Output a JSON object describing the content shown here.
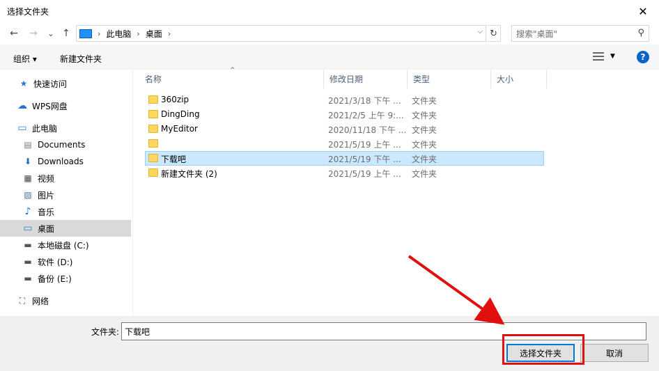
{
  "window": {
    "title": "选择文件夹",
    "close_glyph": "✕"
  },
  "nav": {
    "back_glyph": "←",
    "forward_glyph": "→",
    "recent_glyph": "⌄",
    "up_glyph": "↑",
    "breadcrumbs": [
      "此电脑",
      "桌面"
    ],
    "refresh_glyph": "↻",
    "search_placeholder": "搜索\"桌面\"",
    "search_glyph": "⚲"
  },
  "toolbar": {
    "organize": "组织 ▾",
    "new_folder": "新建文件夹",
    "help": "?"
  },
  "sidebar": {
    "items": [
      {
        "label": "快速访问",
        "icon": "star-icon",
        "glyph": "★"
      },
      {
        "label": "WPS网盘",
        "icon": "cloud-icon",
        "glyph": "☁"
      },
      {
        "label": "此电脑",
        "icon": "computer-icon",
        "glyph": "▭"
      },
      {
        "label": "Documents",
        "icon": "document-icon",
        "glyph": "▤"
      },
      {
        "label": "Downloads",
        "icon": "download-icon",
        "glyph": "⬇"
      },
      {
        "label": "视频",
        "icon": "video-icon",
        "glyph": "▦"
      },
      {
        "label": "图片",
        "icon": "picture-icon",
        "glyph": "▨"
      },
      {
        "label": "音乐",
        "icon": "music-icon",
        "glyph": "♪"
      },
      {
        "label": "桌面",
        "icon": "desktop-icon",
        "glyph": "▭"
      },
      {
        "label": "本地磁盘 (C:)",
        "icon": "disk-icon",
        "glyph": "▬"
      },
      {
        "label": "软件 (D:)",
        "icon": "disk-icon",
        "glyph": "▬"
      },
      {
        "label": "备份 (E:)",
        "icon": "disk-icon",
        "glyph": "▬"
      },
      {
        "label": "网络",
        "icon": "network-icon",
        "glyph": "⛶"
      }
    ]
  },
  "columns": {
    "name": "名称",
    "date": "修改日期",
    "type": "类型",
    "size": "大小"
  },
  "files": [
    {
      "name": "360zip",
      "date": "2021/3/18 下午 ...",
      "type": "文件夹"
    },
    {
      "name": "DingDing",
      "date": "2021/2/5 上午 9:...",
      "type": "文件夹"
    },
    {
      "name": "MyEditor",
      "date": "2020/11/18 下午 ...",
      "type": "文件夹"
    },
    {
      "name": "",
      "date": "2021/5/19 上午 ...",
      "type": "文件夹"
    },
    {
      "name": "下载吧",
      "date": "2021/5/19 下午 ...",
      "type": "文件夹"
    },
    {
      "name": "新建文件夹 (2)",
      "date": "2021/5/19 上午 ...",
      "type": "文件夹"
    }
  ],
  "footer": {
    "folder_label": "文件夹:",
    "folder_value": "下载吧",
    "select_button": "选择文件夹",
    "cancel_button": "取消"
  },
  "colors": {
    "selection": "#cce8ff",
    "accent": "#0078d7",
    "annotation": "#e01010"
  }
}
